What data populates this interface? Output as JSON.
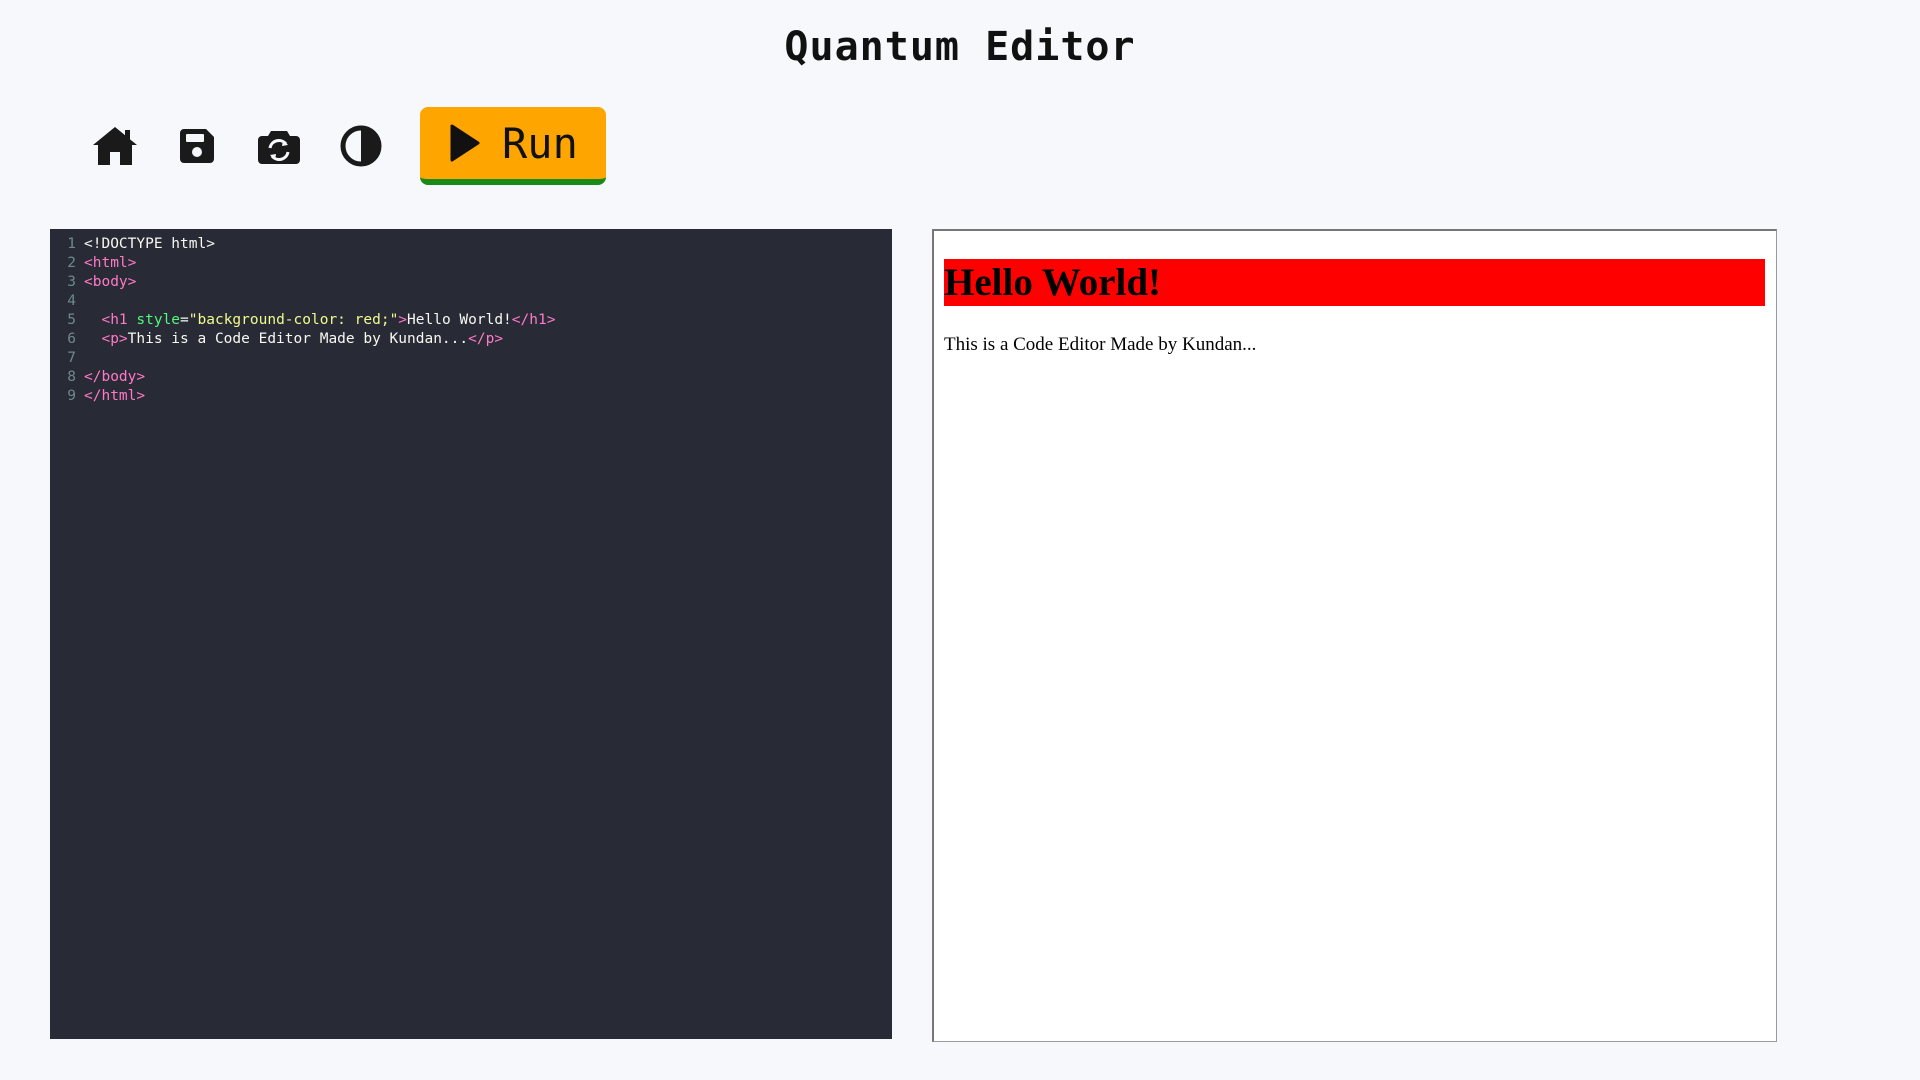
{
  "header": {
    "title": "Quantum Editor"
  },
  "toolbar": {
    "buttons": [
      {
        "name": "home",
        "icon": "home-icon"
      },
      {
        "name": "save",
        "icon": "save-icon"
      },
      {
        "name": "screenshot",
        "icon": "camera-rotate-icon"
      },
      {
        "name": "theme",
        "icon": "half-circle-icon"
      }
    ],
    "run_label": "Run",
    "run_color": "#ffa500",
    "run_underline_color": "#1a8a1a"
  },
  "editor": {
    "line_numbers": [
      "1",
      "2",
      "3",
      "4",
      "5",
      "6",
      "7",
      "8",
      "9"
    ],
    "lines": [
      [
        {
          "t": "<!DOCTYPE html>",
          "k": "txt"
        }
      ],
      [
        {
          "t": "<html>",
          "k": "tag"
        }
      ],
      [
        {
          "t": "<body>",
          "k": "tag"
        }
      ],
      [],
      [
        {
          "t": "  <h1 ",
          "k": "tag"
        },
        {
          "t": "style",
          "k": "attr"
        },
        {
          "t": "=",
          "k": "txt"
        },
        {
          "t": "\"background-color: red;\"",
          "k": "str"
        },
        {
          "t": ">",
          "k": "tag"
        },
        {
          "t": "Hello World!",
          "k": "txt"
        },
        {
          "t": "</h1>",
          "k": "tag"
        }
      ],
      [
        {
          "t": "  <p>",
          "k": "tag"
        },
        {
          "t": "This is a Code Editor Made by Kundan...",
          "k": "txt"
        },
        {
          "t": "</p>",
          "k": "tag"
        }
      ],
      [],
      [
        {
          "t": "</body>",
          "k": "tag"
        }
      ],
      [
        {
          "t": "</html>",
          "k": "tag"
        }
      ]
    ],
    "background": "#282a36"
  },
  "preview": {
    "heading": "Hello World!",
    "heading_bg": "#ff0000",
    "paragraph": "This is a Code Editor Made by Kundan..."
  }
}
